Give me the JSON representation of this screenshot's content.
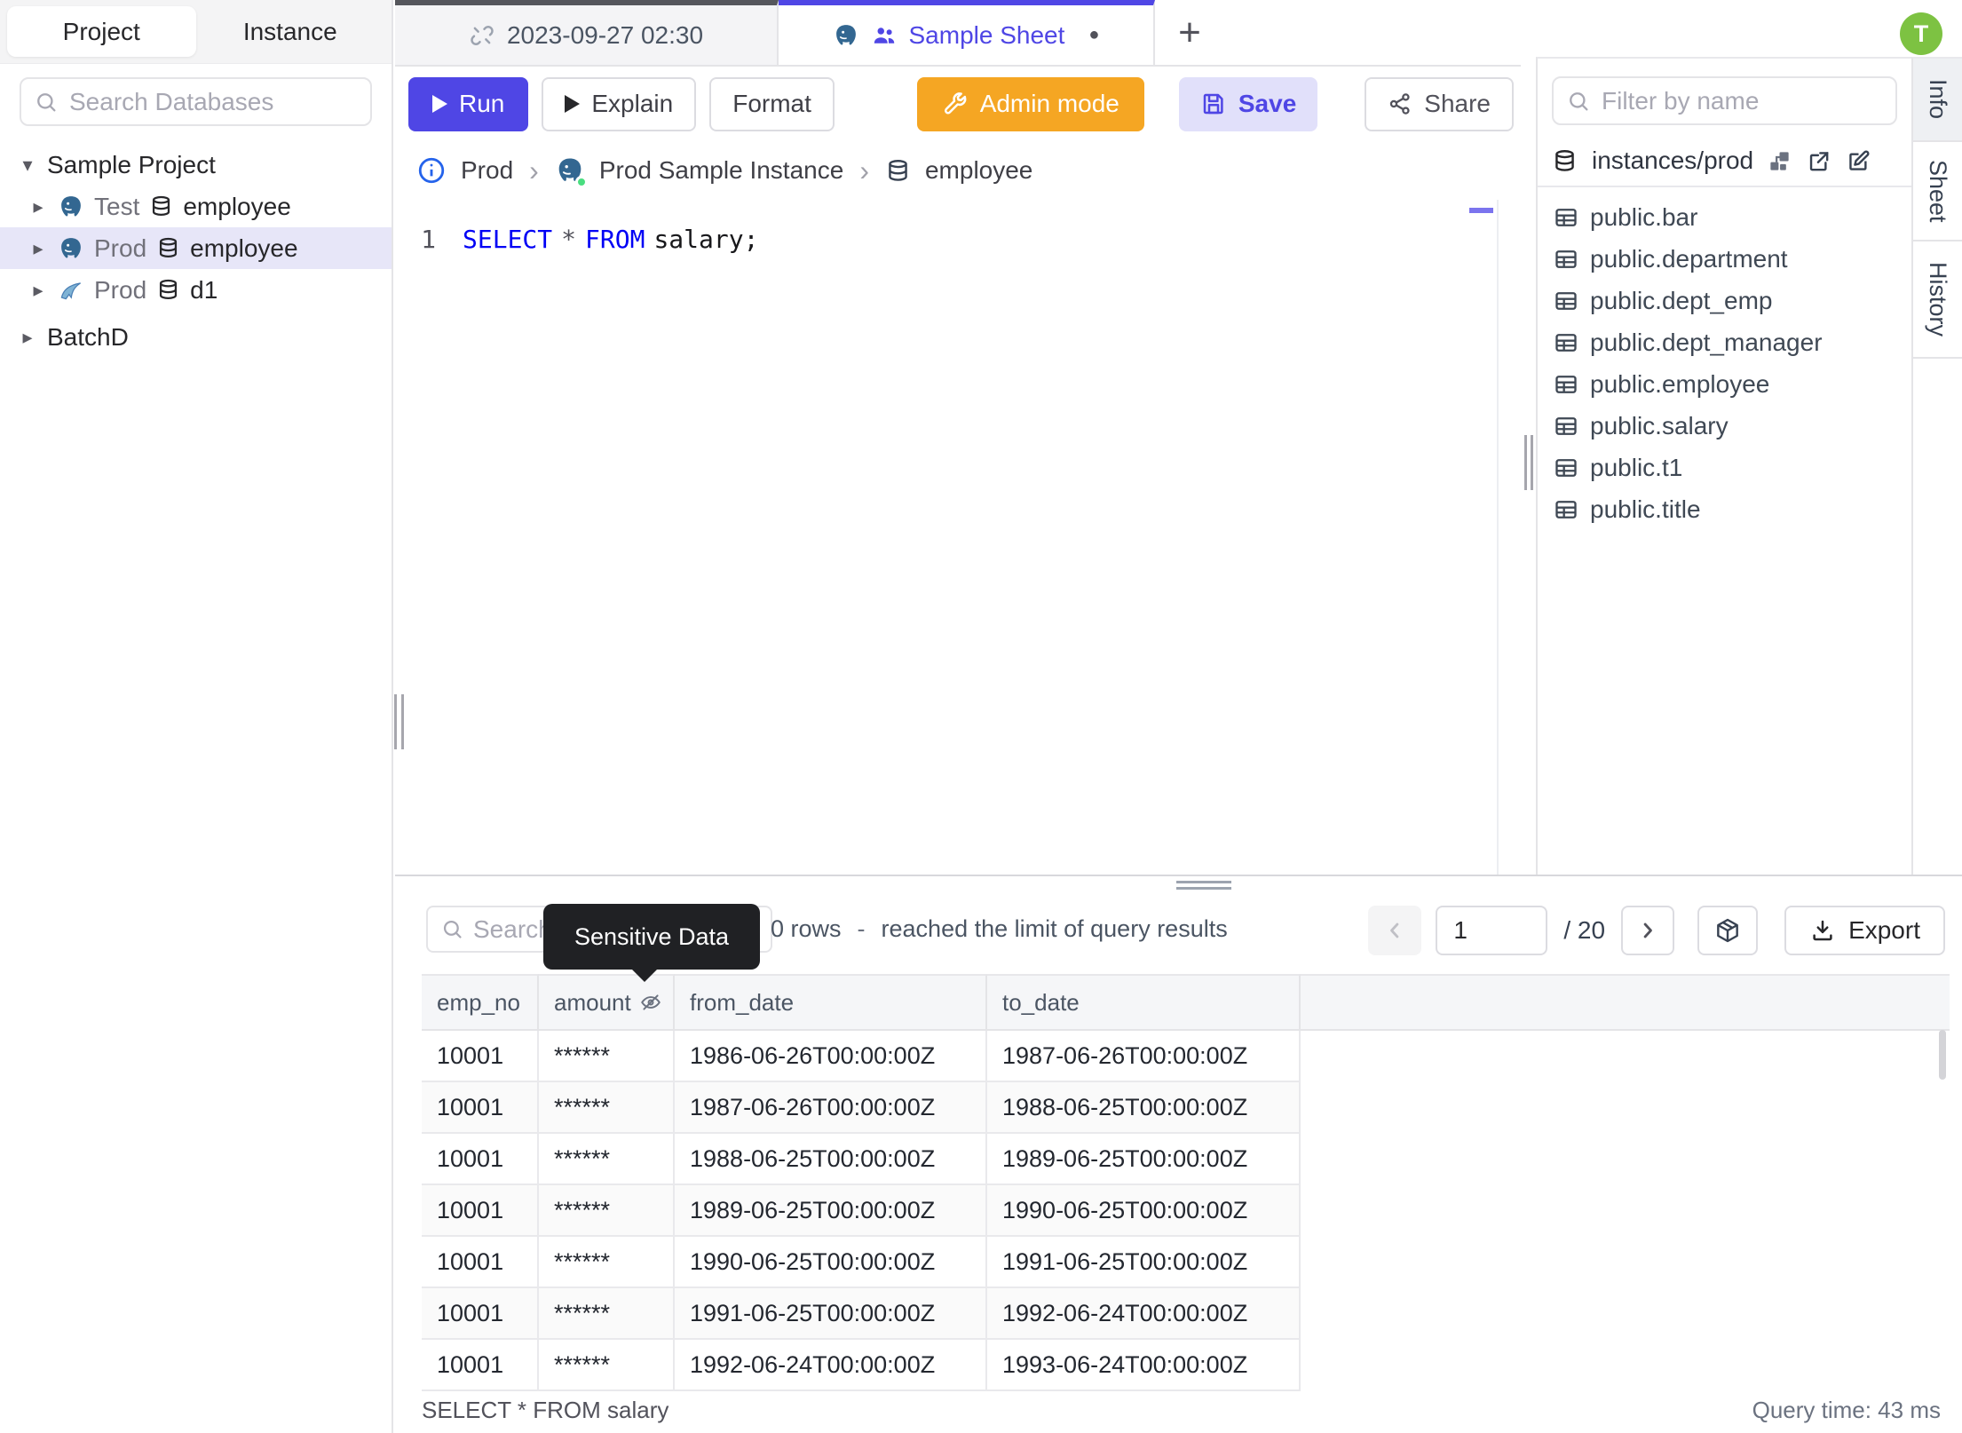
{
  "colors": {
    "accent": "#4f46e5",
    "admin_orange": "#f5a623",
    "avatar_green": "#7dc242",
    "keyword_blue": "#0000f5",
    "tooltip_bg": "#202124",
    "selected_row_bg": "#e7e6f8"
  },
  "left_sidebar": {
    "tab_project": "Project",
    "tab_instance": "Instance",
    "search_placeholder": "Search Databases",
    "tree": {
      "project1": "Sample Project",
      "caret_down": "▾",
      "caret_right": "▸",
      "row_test": {
        "env": "Test",
        "db": "employee"
      },
      "row_prod_employee": {
        "env": "Prod",
        "db": "employee"
      },
      "row_prod_d1": {
        "env": "Prod",
        "db": "d1"
      },
      "project2": "BatchD"
    }
  },
  "tab_bar": {
    "tab1": "2023-09-27 02:30",
    "tab2": "Sample Sheet",
    "dirty_dot": "●",
    "new_tab": "+"
  },
  "header_bar": {
    "avatar_initial": "T"
  },
  "toolbar": {
    "run": "Run",
    "explain": "Explain",
    "format": "Format",
    "admin_mode": "Admin mode",
    "save": "Save",
    "share": "Share"
  },
  "breadcrumb": {
    "env": "Prod",
    "separator": "›",
    "instance": "Prod Sample Instance",
    "database": "employee"
  },
  "editor": {
    "line_number": "1",
    "kw1": "SELECT",
    "star": "*",
    "kw2": "FROM",
    "tail": "salary;"
  },
  "right_sidebar": {
    "filter_placeholder": "Filter by name",
    "header": "instances/prod",
    "tables": [
      "public.bar",
      "public.department",
      "public.dept_emp",
      "public.dept_manager",
      "public.employee",
      "public.salary",
      "public.t1",
      "public.title"
    ]
  },
  "side_tabs": {
    "info": "Info",
    "sheet": "Sheet",
    "history": "History"
  },
  "results": {
    "search_placeholder": "Search",
    "tooltip": "Sensitive Data",
    "row_count": "0 rows",
    "separator": "-",
    "limit_notice": "reached the limit of query results",
    "page_value": "1",
    "page_total": "/ 20",
    "export": "Export",
    "columns": {
      "c1": "emp_no",
      "c2": "amount",
      "c3": "from_date",
      "c4": "to_date"
    },
    "rows": [
      {
        "emp_no": "10001",
        "amount": "******",
        "from": "1986-06-26T00:00:00Z",
        "to": "1987-06-26T00:00:00Z"
      },
      {
        "emp_no": "10001",
        "amount": "******",
        "from": "1987-06-26T00:00:00Z",
        "to": "1988-06-25T00:00:00Z"
      },
      {
        "emp_no": "10001",
        "amount": "******",
        "from": "1988-06-25T00:00:00Z",
        "to": "1989-06-25T00:00:00Z"
      },
      {
        "emp_no": "10001",
        "amount": "******",
        "from": "1989-06-25T00:00:00Z",
        "to": "1990-06-25T00:00:00Z"
      },
      {
        "emp_no": "10001",
        "amount": "******",
        "from": "1990-06-25T00:00:00Z",
        "to": "1991-06-25T00:00:00Z"
      },
      {
        "emp_no": "10001",
        "amount": "******",
        "from": "1991-06-25T00:00:00Z",
        "to": "1992-06-24T00:00:00Z"
      },
      {
        "emp_no": "10001",
        "amount": "******",
        "from": "1992-06-24T00:00:00Z",
        "to": "1993-06-24T00:00:00Z"
      }
    ],
    "status_left": "SELECT * FROM salary",
    "status_right": "Query time: 43 ms"
  }
}
